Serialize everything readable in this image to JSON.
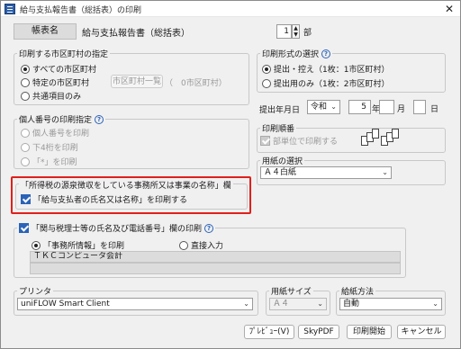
{
  "window": {
    "title": "給与支払報告書（総括表）の印刷",
    "close": "✕"
  },
  "form_name": {
    "label": "帳表名",
    "value": "給与支払報告書（総括表）",
    "copies": "1",
    "copies_unit": "部"
  },
  "municipality": {
    "title": "印刷する市区町村の指定",
    "options": [
      "すべての市区町村",
      "特定の市区町村",
      "共通項目のみ"
    ],
    "list_button": "市区町村一覧",
    "count_text": "（　0市区町村）"
  },
  "individual_number": {
    "title": "個人番号の印刷指定",
    "options": [
      "個人番号を印刷",
      "下4桁を印刷",
      "「*」を印刷"
    ]
  },
  "withholding": {
    "title": "「所得税の源泉徴収をしている事務所又は事業の名称」欄",
    "checkbox_label": "「給与支払者の氏名又は名称」を印刷する"
  },
  "tax_accountant": {
    "checkbox_label": "「関与税理士等の氏名及び電話番号」欄の印刷",
    "options": [
      "「事務所情報」を印刷",
      "直接入力"
    ],
    "office_name": "ＴＫＣコンピュータ会計"
  },
  "print_format": {
    "title": "印刷形式の選択",
    "options": [
      "提出・控え（1枚：1市区町村）",
      "提出用のみ（1枚：2市区町村）"
    ]
  },
  "submit_date": {
    "label": "提出年月日",
    "era": "令和",
    "year": "5",
    "year_unit": "年",
    "month": "",
    "month_unit": "月",
    "day": "",
    "day_unit": "日"
  },
  "print_order": {
    "title": "印刷順番",
    "checkbox_label": "部単位で印刷する"
  },
  "paper": {
    "title": "用紙の選択",
    "value": "Ａ４白紙"
  },
  "printer": {
    "label": "プリンタ",
    "value": "uniFLOW Smart Client"
  },
  "paper_size": {
    "label": "用紙サイズ",
    "value": "Ａ４"
  },
  "feed": {
    "label": "給紙方法",
    "value": "自動"
  },
  "buttons": {
    "preview": "ﾌﾟﾚﾋﾞｭｰ(V)",
    "skypdf": "SkyPDF",
    "print": "印刷開始",
    "cancel": "キャンセル"
  }
}
